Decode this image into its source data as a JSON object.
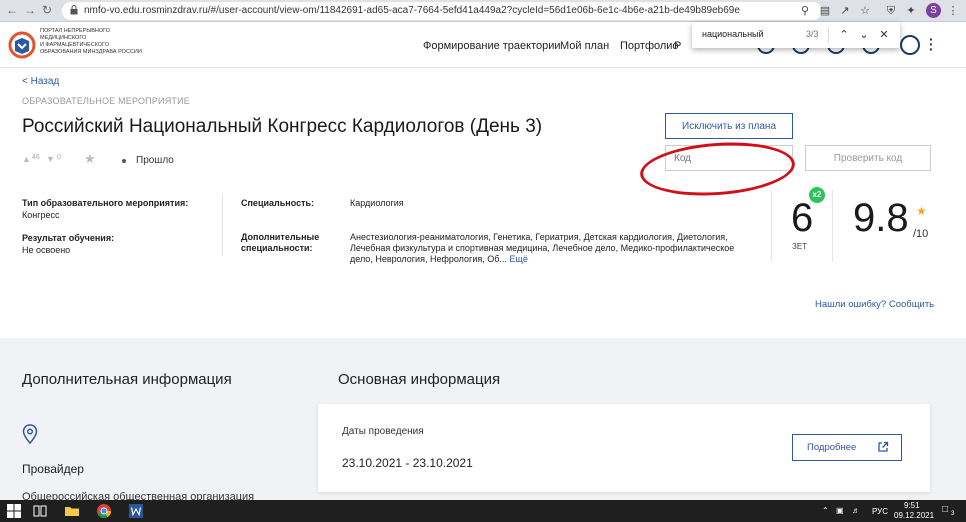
{
  "browser": {
    "url": "nmfo-vo.edu.rosminzdrav.ru/#/user-account/view-om/11842691-ad65-aca7-7664-5efd41a449a2?cycleId=56d1e06b-6e1c-4b6e-a21b-de49b89eb69e",
    "profile_initial": "S",
    "find_query": "национальный",
    "find_count": "3/3"
  },
  "header": {
    "logo_lines": [
      "ПОРТАЛ НЕПРЕРЫВНОГО",
      "МЕДИЦИНСКОГО",
      "И ФАРМАЦЕВТИЧЕСКОГО",
      "ОБРАЗОВАНИЯ МИНЗДРАВА РОССИИ"
    ],
    "menu": [
      "Формирование траектории",
      "Мой план",
      "Портфолио",
      "Р"
    ]
  },
  "event": {
    "back_label": "< Назад",
    "category": "ОБРАЗОВАТЕЛЬНОЕ МЕРОПРИЯТИЕ",
    "title": "Российский Национальный Конгресс Кардиологов (День 3)",
    "likes": "46",
    "dislikes": "0",
    "status": "Прошло",
    "exclude_button": "Исключить из плана",
    "code_placeholder": "Код",
    "verify_button": "Проверить код",
    "fields": {
      "type_label": "Тип образовательного мероприятия:",
      "type_value": "Конгресс",
      "result_label": "Результат обучения:",
      "result_value": "Не освоено",
      "spec_label": "Специальность:",
      "spec_value": "Кардиология",
      "addspec_label_1": "Дополнительные",
      "addspec_label_2": "специальности:",
      "addspec_line_1": "Анестезиология-реаниматология, Генетика, Гериатрия, Детская кардиология, Диетология,",
      "addspec_line_2": "Лечебная физкультура и спортивная медицина, Лечебное дело, Медико-профилактическое",
      "addspec_line_3": "дело, Неврология, Нефрология, Об...",
      "more_link": "Ещё"
    },
    "zet_value": "6",
    "zet_label": "ЗЕТ",
    "zet_badge": "x2",
    "rating": "9.8",
    "rating_out_of": "/10",
    "report_link": "Нашли ошибку? Сообщить"
  },
  "lower": {
    "additional_title": "Дополнительная информация",
    "provider_label": "Провайдер",
    "provider_org": "Общероссийская общественная организация",
    "main_title": "Основная информация",
    "dates_label": "Даты проведения",
    "dates_value": "23.10.2021 - 23.10.2021",
    "more_button": "Подробнее"
  },
  "taskbar": {
    "time": "9:51",
    "date": "09.12.2021",
    "lang": "РУС",
    "notifications": "3"
  },
  "colors": {
    "accent": "#2c5aa0",
    "badge_green": "#2cc45b",
    "highlight_red": "#d10f18",
    "star": "#f5a623"
  }
}
